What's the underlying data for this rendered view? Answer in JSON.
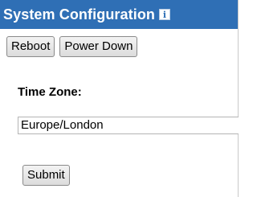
{
  "header": {
    "title": "System Configuration",
    "info_icon": "info-icon"
  },
  "toolbar": {
    "reboot_label": "Reboot",
    "power_down_label": "Power Down"
  },
  "form": {
    "timezone_label": "Time Zone:",
    "timezone_value": "Europe/London",
    "submit_label": "Submit"
  },
  "colors": {
    "header_bg": "#2f6fb5",
    "header_text": "#ffffff"
  }
}
